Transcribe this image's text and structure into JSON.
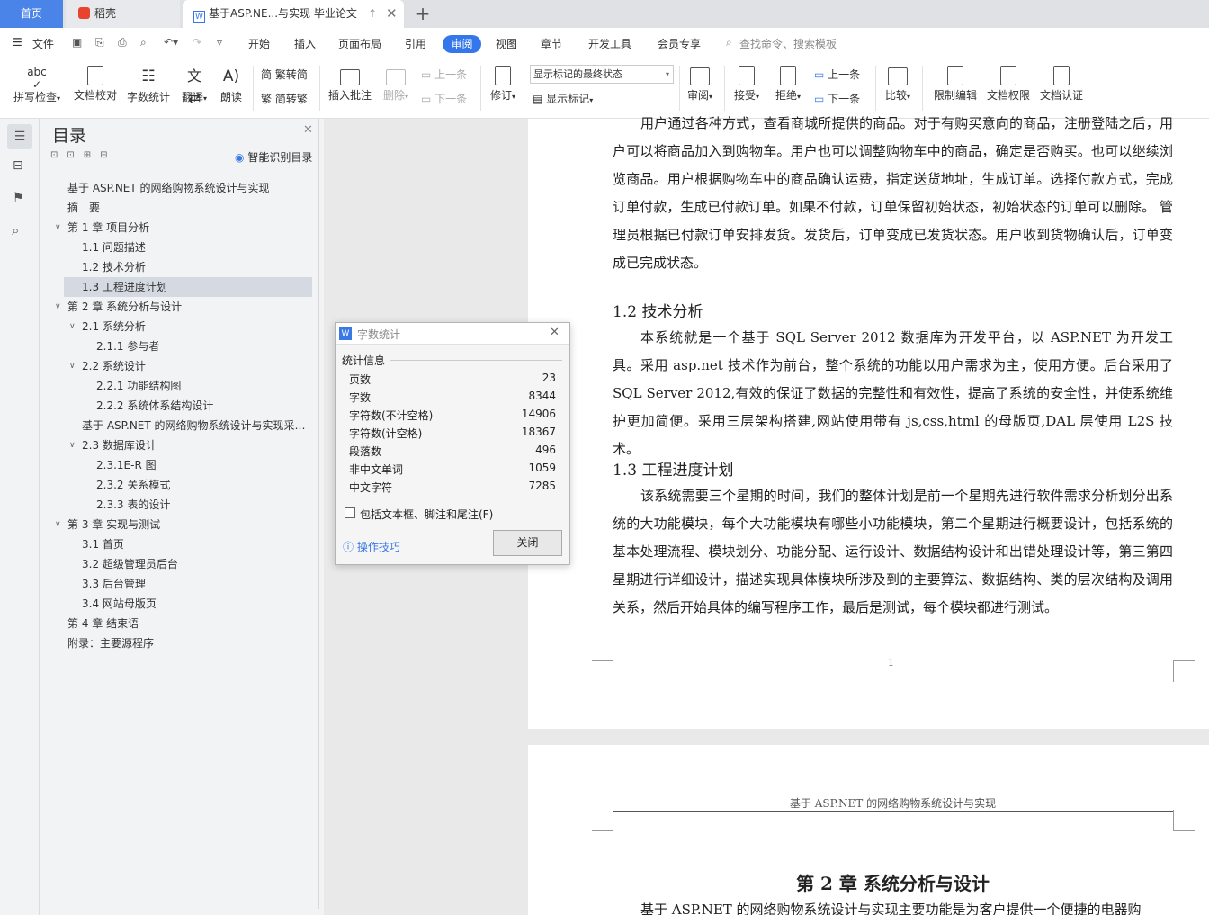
{
  "tabs": {
    "home": "首页",
    "daoke": "稻壳",
    "doc": "基于ASP.NE...与实现 毕业论文"
  },
  "menu": {
    "file": "文件",
    "items": [
      "开始",
      "插入",
      "页面布局",
      "引用",
      "审阅",
      "视图",
      "章节",
      "开发工具",
      "会员专享"
    ],
    "search_placeholder": "查找命令、搜索模板"
  },
  "ribbon": {
    "spell": "拼写检查",
    "proof": "文档校对",
    "wordcount": "字数统计",
    "translate": "翻译",
    "read": "朗读",
    "trad": "繁转简",
    "simp": "简转繁",
    "insert_comment": "插入批注",
    "delete": "删除",
    "prev_comment": "上一条",
    "next_comment": "下一条",
    "revise": "修订",
    "markup_select": "显示标记的最终状态",
    "show_markup": "显示标记",
    "review": "审阅",
    "accept": "接受",
    "reject": "拒绝",
    "prev": "上一条",
    "next": "下一条",
    "compare": "比较",
    "restrict": "限制编辑",
    "perm": "文档权限",
    "auth": "文档认证"
  },
  "toc": {
    "title": "目录",
    "smart": "智能识别目录",
    "items": [
      "基于 ASP.NET 的网络购物系统设计与实现",
      "摘　要",
      "第 1 章  项目分析",
      "1.1  问题描述",
      "1.2 技术分析",
      "1.3 工程进度计划",
      "第 2 章  系统分析与设计",
      "2.1  系统分析",
      "2.1.1  参与者",
      "2.2  系统设计",
      "2.2.1 功能结构图",
      "2.2.2 系统体系结构设计",
      "基于 ASP.NET 的网络购物系统设计与实现采…",
      "2.3  数据库设计",
      "2.3.1E-R 图",
      "2.3.2 关系模式",
      "2.3.3 表的设计",
      "第 3 章  实现与测试",
      "3.1  首页",
      "3.2  超级管理员后台",
      "3.3  后台管理",
      "3.4  网站母版页",
      "第 4 章  结束语",
      "附录：主要源程序"
    ]
  },
  "document": {
    "para1": "用户通过各种方式，查看商城所提供的商品。对于有购买意向的商品，注册登陆之后，用户可以将商品加入到购物车。用户也可以调整购物车中的商品，确定是否购买。也可以继续浏览商品。用户根据购物车中的商品确认运费，指定送货地址，生成订单。选择付款方式，完成订单付款，生成已付款订单。如果不付款，订单保留初始状态，初始状态的订单可以删除。 管理员根据已付款订单安排发货。发货后，订单变成已发货状态。用户收到货物确认后，订单变成已完成状态。",
    "h12": "1.2 技术分析",
    "para2": "本系统就是一个基于 SQL Server 2012 数据库为开发平台，以 ASP.NET 为开发工具。采用 asp.net 技术作为前台，整个系统的功能以用户需求为主，使用方便。后台采用了 SQL Server 2012,有效的保证了数据的完整性和有效性，提高了系统的安全性，并使系统维护更加简便。采用三层架构搭建,网站使用带有 js,css,html 的母版页,DAL 层使用 L2S 技术。",
    "h13": "1.3 工程进度计划",
    "para3": "该系统需要三个星期的时间，我们的整体计划是前一个星期先进行软件需求分析划分出系统的大功能模块，每个大功能模块有哪些小功能模块，第二个星期进行概要设计，包括系统的基本处理流程、模块划分、功能分配、运行设计、数据结构设计和出错处理设计等，第三第四星期进行详细设计，描述实现具体模块所涉及到的主要算法、数据结构、类的层次结构及调用关系，然后开始具体的编写程序工作，最后是测试，每个模块都进行测试。",
    "page_number": "1",
    "header2": "基于 ASP.NET 的网络购物系统设计与实现",
    "chapter2": "第 2 章  系统分析与设计",
    "para4": "基于 ASP.NET 的网络购物系统设计与实现主要功能是为客户提供一个便捷的电器购"
  },
  "dialog": {
    "title": "字数统计",
    "section": "统计信息",
    "rows": [
      {
        "label": "页数",
        "value": "23"
      },
      {
        "label": "字数",
        "value": "8344"
      },
      {
        "label": "字符数(不计空格)",
        "value": "14906"
      },
      {
        "label": "字符数(计空格)",
        "value": "18367"
      },
      {
        "label": "段落数",
        "value": "496"
      },
      {
        "label": "非中文单词",
        "value": "1059"
      },
      {
        "label": "中文字符",
        "value": "7285"
      }
    ],
    "checkbox": "包括文本框、脚注和尾注(F)",
    "tips": "操作技巧",
    "close": "关闭"
  }
}
